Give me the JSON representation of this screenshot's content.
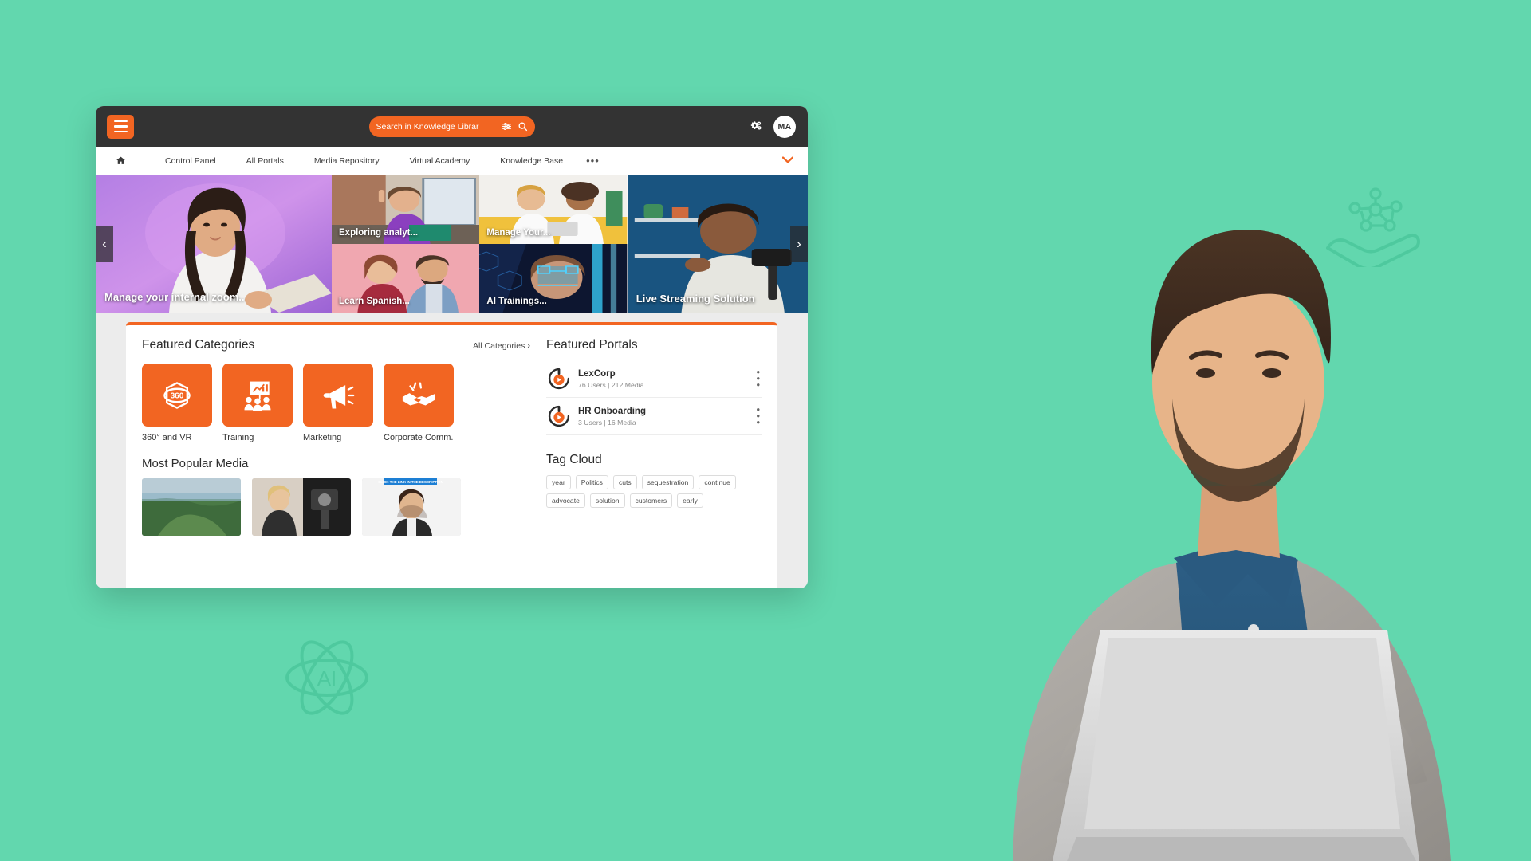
{
  "header": {
    "menu_icon": "hamburger-icon",
    "search": {
      "placeholder": "Search in Knowledge Librar",
      "value": "Search in Knowledge Librar"
    },
    "filter_icon": "sliders-icon",
    "search_icon": "search-icon",
    "settings_icon": "gears-icon",
    "avatar_initials": "MA"
  },
  "nav": {
    "home_icon": "home-icon",
    "items": [
      {
        "label": "Control Panel"
      },
      {
        "label": "All Portals"
      },
      {
        "label": "Media Repository"
      },
      {
        "label": "Virtual Academy"
      },
      {
        "label": "Knowledge Base"
      }
    ],
    "more_label": "•••",
    "caret_icon": "chevron-down-icon"
  },
  "carousel": {
    "prev_icon": "‹",
    "next_icon": "›",
    "main_caption": "Manage your internal zoom..",
    "tiles": [
      {
        "caption": "Exploring analyt..."
      },
      {
        "caption": "Manage Your..."
      },
      {
        "caption": "Live Streaming Solution"
      },
      {
        "caption": "Learn Spanish..."
      },
      {
        "caption": "AI Trainings..."
      }
    ]
  },
  "featured_categories": {
    "title": "Featured Categories",
    "all_link": "All Categories",
    "all_chevron": "›",
    "items": [
      {
        "label": "360° and VR",
        "icon": "vr-360-icon"
      },
      {
        "label": "Training",
        "icon": "training-presentation-icon"
      },
      {
        "label": "Marketing",
        "icon": "megaphone-icon"
      },
      {
        "label": "Corporate Comm..",
        "icon": "handshake-icon"
      }
    ]
  },
  "most_popular": {
    "title": "Most Popular Media",
    "items": [
      {
        "caption": ""
      },
      {
        "caption": ""
      },
      {
        "caption": "CLICK THE LINK IN THE DESCRIPTION"
      }
    ]
  },
  "featured_portals": {
    "title": "Featured Portals",
    "items": [
      {
        "name": "LexCorp",
        "meta": "76 Users | 212 Media",
        "logo": "portal-play-icon",
        "menu": "kebab-menu-icon"
      },
      {
        "name": "HR Onboarding",
        "meta": "3 Users | 16 Media",
        "logo": "portal-play-icon",
        "menu": "kebab-menu-icon"
      }
    ]
  },
  "tag_cloud": {
    "title": "Tag Cloud",
    "tags": [
      "year",
      "Politics",
      "cuts",
      "sequestration",
      "continue",
      "advocate",
      "solution",
      "customers",
      "early"
    ]
  },
  "colors": {
    "background": "#62d7ae",
    "accent": "#f26522",
    "topbar": "#333333",
    "panel_bg": "#ececec"
  }
}
